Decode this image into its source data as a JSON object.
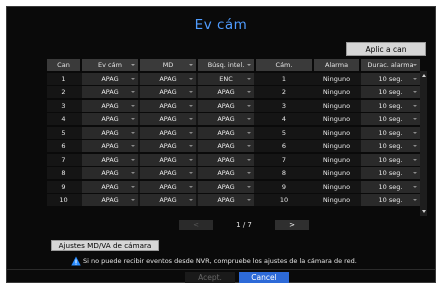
{
  "dialog": {
    "title": "Ev cám",
    "apply_all_label": "Aplic a can",
    "colors": {
      "accent": "#4f9cff",
      "cancel": "#2d6ad8",
      "warning": "#2a8cff"
    }
  },
  "table": {
    "headers": [
      "Can",
      "Ev cám",
      "MD",
      "Búsq. intel.",
      "Cám.",
      "Alarma",
      "Durac. alarma"
    ],
    "rows": [
      {
        "can": "1",
        "ev": "APAG",
        "md": "APAG",
        "busq": "ENC",
        "cam": "1",
        "alarma": "Ninguno",
        "durac": "10 seg."
      },
      {
        "can": "2",
        "ev": "APAG",
        "md": "APAG",
        "busq": "APAG",
        "cam": "2",
        "alarma": "Ninguno",
        "durac": "10 seg."
      },
      {
        "can": "3",
        "ev": "APAG",
        "md": "APAG",
        "busq": "APAG",
        "cam": "3",
        "alarma": "Ninguno",
        "durac": "10 seg."
      },
      {
        "can": "4",
        "ev": "APAG",
        "md": "APAG",
        "busq": "APAG",
        "cam": "4",
        "alarma": "Ninguno",
        "durac": "10 seg."
      },
      {
        "can": "5",
        "ev": "APAG",
        "md": "APAG",
        "busq": "APAG",
        "cam": "5",
        "alarma": "Ninguno",
        "durac": "10 seg."
      },
      {
        "can": "6",
        "ev": "APAG",
        "md": "APAG",
        "busq": "APAG",
        "cam": "6",
        "alarma": "Ninguno",
        "durac": "10 seg."
      },
      {
        "can": "7",
        "ev": "APAG",
        "md": "APAG",
        "busq": "APAG",
        "cam": "7",
        "alarma": "Ninguno",
        "durac": "10 seg."
      },
      {
        "can": "8",
        "ev": "APAG",
        "md": "APAG",
        "busq": "APAG",
        "cam": "8",
        "alarma": "Ninguno",
        "durac": "10 seg."
      },
      {
        "can": "9",
        "ev": "APAG",
        "md": "APAG",
        "busq": "APAG",
        "cam": "9",
        "alarma": "Ninguno",
        "durac": "10 seg."
      },
      {
        "can": "10",
        "ev": "APAG",
        "md": "APAG",
        "busq": "APAG",
        "cam": "10",
        "alarma": "Ninguno",
        "durac": "10 seg."
      }
    ]
  },
  "pager": {
    "text": "1 / 7",
    "prev_label": "<",
    "next_label": ">"
  },
  "md_button_label": "Ajustes MD/VA de cámara",
  "notice_text": "Si no puede recibir eventos desde NVR, compruebe los ajustes de la cámara de red.",
  "footer": {
    "accept_label": "Acept.",
    "cancel_label": "Cancel"
  }
}
